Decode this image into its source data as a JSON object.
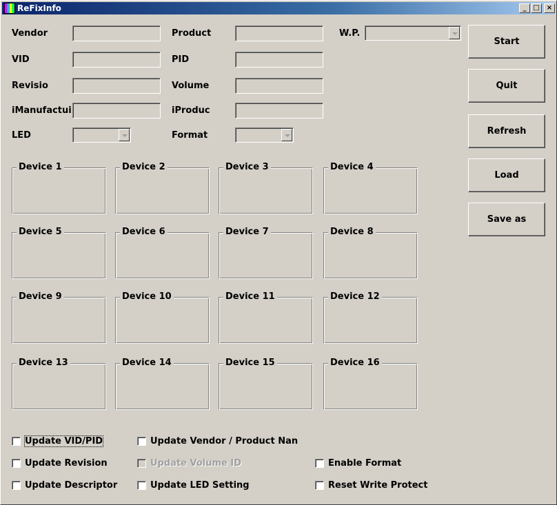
{
  "window": {
    "title": "ReFixInfo",
    "minimize": "_",
    "maximize": "□",
    "close": "×"
  },
  "fields": {
    "vendor_label": "Vendor",
    "product_label": "Product",
    "wp_label": "W.P.",
    "vid_label": "VID",
    "pid_label": "PID",
    "revision_label": "Revisio",
    "volume_label": "Volume",
    "imanufacturer_label": "iManufactui",
    "iproduct_label": "iProduc",
    "led_label": "LED",
    "format_label": "Format",
    "vendor_value": "",
    "product_value": "",
    "vid_value": "",
    "pid_value": "",
    "revision_value": "",
    "volume_value": "",
    "imanufacturer_value": "",
    "iproduct_value": "",
    "wp_value": "",
    "led_value": "",
    "format_value": ""
  },
  "buttons": {
    "start": "Start",
    "quit": "Quit",
    "refresh": "Refresh",
    "load": "Load",
    "save_as": "Save as"
  },
  "devices": [
    "Device 1",
    "Device 2",
    "Device 3",
    "Device 4",
    "Device 5",
    "Device 6",
    "Device 7",
    "Device 8",
    "Device 9",
    "Device 10",
    "Device 11",
    "Device 12",
    "Device 13",
    "Device 14",
    "Device 15",
    "Device 16"
  ],
  "checkboxes": {
    "update_vid_pid": "Update VID/PID",
    "update_vendor_product": "Update Vendor / Product Nan",
    "update_revision": "Update Revision",
    "update_volume_id": "Update Volume ID",
    "enable_format": "Enable Format",
    "update_descriptor": "Update Descriptor",
    "update_led_setting": "Update LED Setting",
    "reset_write_protect": "Reset Write Protect"
  }
}
